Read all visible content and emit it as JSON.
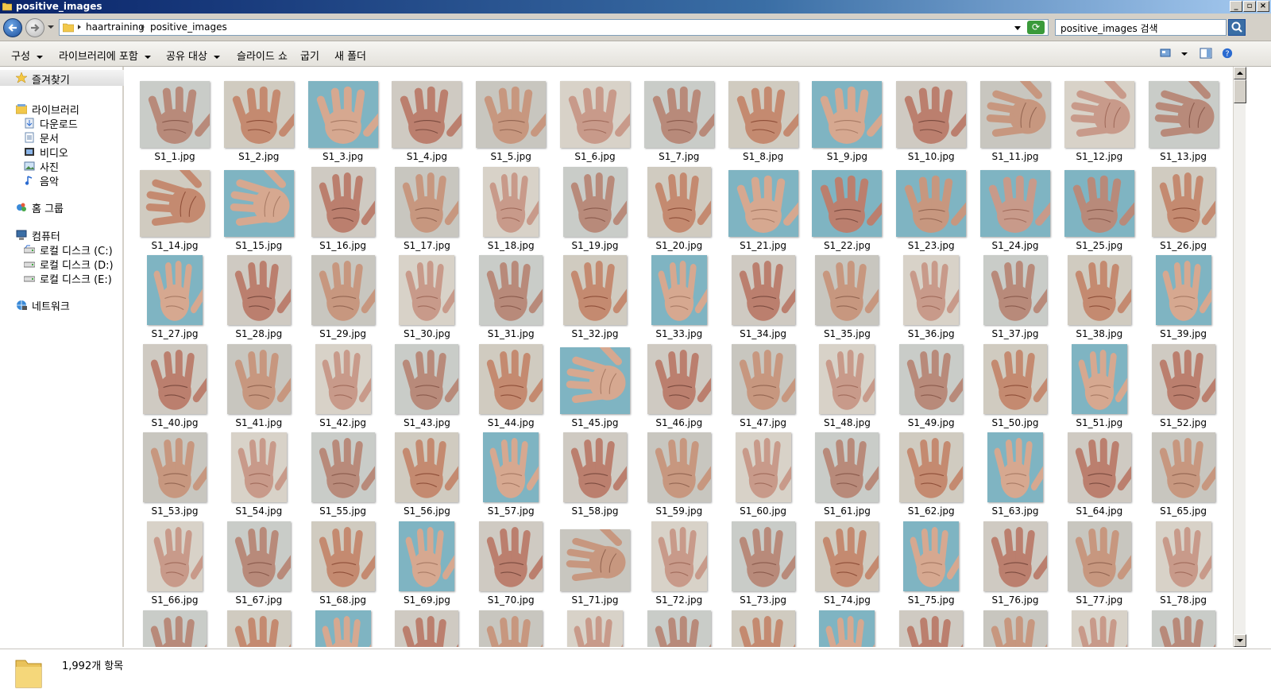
{
  "window": {
    "title": "positive_images"
  },
  "address": {
    "crumbs": [
      "haartraining",
      "positive_images"
    ],
    "search_placeholder": "positive_images 검색"
  },
  "toolbar": {
    "organize": "구성",
    "include_in_library": "라이브러리에 포함",
    "share_with": "공유 대상",
    "slideshow": "슬라이드 쇼",
    "burn": "굽기",
    "new_folder": "새 폴더"
  },
  "nav": {
    "favorites": "즐겨찾기",
    "libraries": "라이브러리",
    "lib_items": [
      "다운로드",
      "문서",
      "비디오",
      "사진",
      "음악"
    ],
    "homegroup": "홈 그룹",
    "computer": "컴퓨터",
    "drives": [
      "로컬 디스크 (C:)",
      "로컬 디스크 (D:)",
      "로컬 디스크 (E:)"
    ],
    "network": "네트워크"
  },
  "files": {
    "prefix": "S1_",
    "ext": ".jpg",
    "first": 1,
    "last": 78
  },
  "status": {
    "item_count": "1,992개 항목"
  },
  "colors": {
    "titlebar_start": "#0a246a",
    "accent": "#3a6ea5",
    "chrome": "#d4d0c8"
  }
}
